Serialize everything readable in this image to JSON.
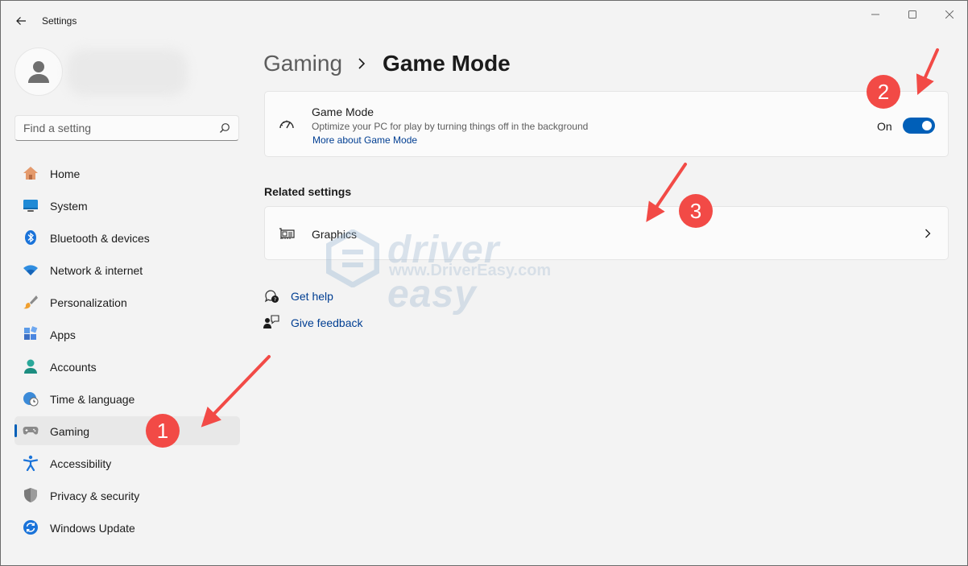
{
  "window": {
    "title": "Settings"
  },
  "search": {
    "placeholder": "Find a setting"
  },
  "nav": {
    "items": [
      {
        "label": "Home"
      },
      {
        "label": "System"
      },
      {
        "label": "Bluetooth & devices"
      },
      {
        "label": "Network & internet"
      },
      {
        "label": "Personalization"
      },
      {
        "label": "Apps"
      },
      {
        "label": "Accounts"
      },
      {
        "label": "Time & language"
      },
      {
        "label": "Gaming",
        "active": true
      },
      {
        "label": "Accessibility"
      },
      {
        "label": "Privacy & security"
      },
      {
        "label": "Windows Update"
      }
    ]
  },
  "breadcrumb": {
    "parent": "Gaming",
    "current": "Game Mode"
  },
  "game_mode": {
    "title": "Game Mode",
    "description": "Optimize your PC for play by turning things off in the background",
    "link": "More about Game Mode",
    "toggle_state": "On"
  },
  "related": {
    "heading": "Related settings",
    "graphics_label": "Graphics"
  },
  "help": {
    "get_help": "Get help",
    "give_feedback": "Give feedback"
  },
  "watermark": {
    "brand": "driver easy",
    "url": "www.DriverEasy.com"
  },
  "annotations": {
    "step1": "1",
    "step2": "2",
    "step3": "3"
  },
  "colors": {
    "accent": "#005fb8",
    "link": "#003e92",
    "annotation": "#f24a46"
  }
}
